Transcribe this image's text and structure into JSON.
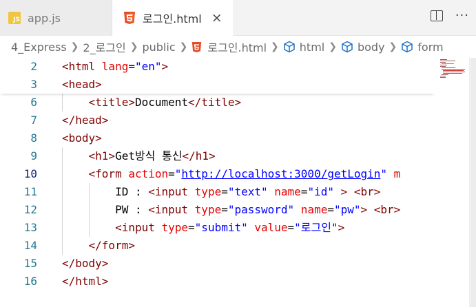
{
  "tabs": [
    {
      "icon": "js-file-icon",
      "icon_text": "JS",
      "label": "app.js",
      "active": false
    },
    {
      "icon": "html5-file-icon",
      "label": "로그인.html",
      "active": true,
      "close": "×"
    }
  ],
  "breadcrumb": [
    "4_Express",
    "2_로그인",
    "public",
    "로그인.html",
    "html",
    "body",
    "form"
  ],
  "editor": {
    "sticky_lines": [
      {
        "num": "2",
        "tokens": [
          [
            "tag",
            "<html "
          ],
          [
            "attr",
            "lang"
          ],
          [
            "txt",
            "="
          ],
          [
            "str",
            "\"en\""
          ],
          [
            "tag",
            ">"
          ]
        ]
      },
      {
        "num": "3",
        "tokens": [
          [
            "tag",
            "<head>"
          ]
        ]
      }
    ],
    "lines": [
      {
        "num": "6",
        "tokens": [
          [
            "tag",
            "    <title>"
          ],
          [
            "txt",
            "Document"
          ],
          [
            "tag",
            "</title>"
          ]
        ]
      },
      {
        "num": "7",
        "tokens": [
          [
            "tag",
            "</head>"
          ]
        ]
      },
      {
        "num": "8",
        "tokens": [
          [
            "tag",
            "<body>"
          ]
        ]
      },
      {
        "num": "9",
        "tokens": [
          [
            "tag",
            "    <h1>"
          ],
          [
            "txt",
            "Get방식 통신"
          ],
          [
            "tag",
            "</h1>"
          ]
        ]
      },
      {
        "num": "10",
        "active": true,
        "tokens": [
          [
            "tag",
            "    <form "
          ],
          [
            "attr",
            "action"
          ],
          [
            "txt",
            "="
          ],
          [
            "str",
            "\""
          ],
          [
            "link",
            "http://localhost:3000/getLogin"
          ],
          [
            "str",
            "\""
          ],
          [
            "attr",
            " m"
          ]
        ]
      },
      {
        "num": "11",
        "tokens": [
          [
            "txt",
            "        ID : "
          ],
          [
            "tag",
            "<input "
          ],
          [
            "attr",
            "type"
          ],
          [
            "txt",
            "="
          ],
          [
            "str",
            "\"text\""
          ],
          [
            "attr",
            " name"
          ],
          [
            "txt",
            "="
          ],
          [
            "str",
            "\"id\""
          ],
          [
            "tag",
            " > <br>"
          ]
        ]
      },
      {
        "num": "12",
        "tokens": [
          [
            "txt",
            "        PW : "
          ],
          [
            "tag",
            "<input "
          ],
          [
            "attr",
            "type"
          ],
          [
            "txt",
            "="
          ],
          [
            "str",
            "\"password\""
          ],
          [
            "attr",
            " name"
          ],
          [
            "txt",
            "="
          ],
          [
            "str",
            "\"pw\""
          ],
          [
            "tag",
            "> <br>"
          ]
        ]
      },
      {
        "num": "13",
        "tokens": [
          [
            "tag",
            "        <input "
          ],
          [
            "attr",
            "type"
          ],
          [
            "txt",
            "="
          ],
          [
            "str",
            "\"submit\""
          ],
          [
            "attr",
            " value"
          ],
          [
            "txt",
            "="
          ],
          [
            "str",
            "\"로그인\""
          ],
          [
            "tag",
            ">"
          ]
        ]
      },
      {
        "num": "14",
        "tokens": [
          [
            "tag",
            "    </form>"
          ]
        ]
      },
      {
        "num": "15",
        "tokens": [
          [
            "tag",
            "</body>"
          ]
        ]
      },
      {
        "num": "16",
        "tokens": [
          [
            "tag",
            "</html>"
          ]
        ]
      }
    ]
  },
  "colors": {
    "tag": "#800000",
    "attr": "#e50000",
    "string": "#0000ff",
    "line_number": "#237893",
    "active_line_number": "#0b216f"
  }
}
